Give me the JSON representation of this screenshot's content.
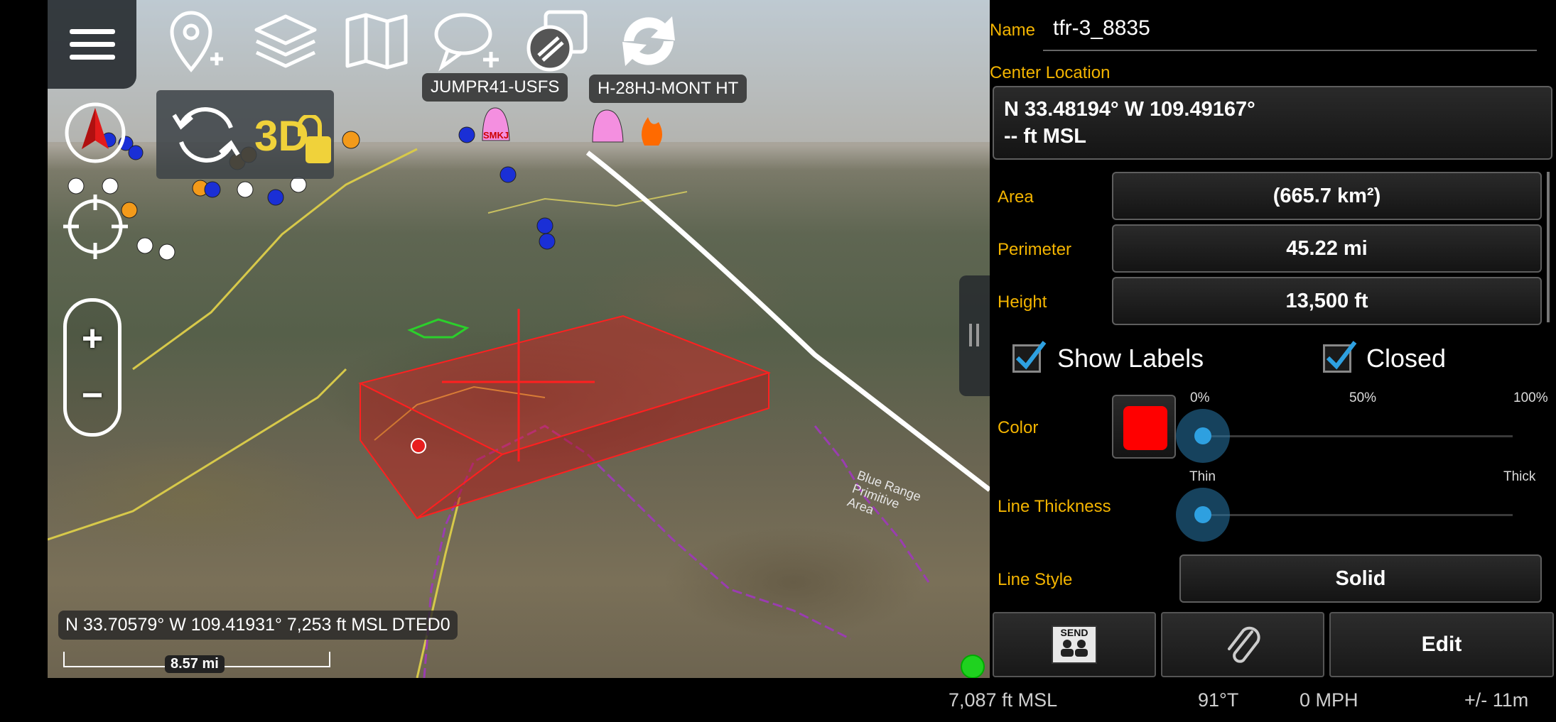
{
  "map": {
    "callsign_labels": [
      "JUMPR41-USFS",
      "H-28HJ-MONT HT"
    ],
    "marker_text": "SMKJ",
    "terrain_label": "Blue Range Primitive Area",
    "lock_mode": "3D",
    "zoom_in": "+",
    "zoom_out": "−",
    "coord_readout": "N 33.70579°  W 109.41931° 7,253 ft MSL DTED0",
    "scale_label": "8.57 mi",
    "shape_color": "#ff0000"
  },
  "toolbar": {
    "icons": [
      "menu-icon",
      "add-point-icon",
      "layers-icon",
      "map-icon",
      "add-chat-icon",
      "overlay-icon",
      "sync-icon"
    ]
  },
  "details": {
    "name_label": "Name",
    "name_value": "tfr-3_8835",
    "center_label": "Center Location",
    "center_line1": "N 33.48194°  W 109.49167°",
    "center_line2": "-- ft MSL",
    "area_label": "Area",
    "area_value": "(665.7 km²)",
    "perimeter_label": "Perimeter",
    "perimeter_value": "45.22 mi",
    "height_label": "Height",
    "height_value": "13,500 ft",
    "show_labels": "Show Labels",
    "show_labels_checked": true,
    "closed": "Closed",
    "closed_checked": true,
    "color_label": "Color",
    "color_value": "#ff0000",
    "opacity_ticks": [
      "0%",
      "50%",
      "100%"
    ],
    "opacity_percent": 0,
    "thickness_label": "Line Thickness",
    "thickness_ticks": [
      "Thin",
      "Thick"
    ],
    "thickness_fraction": 0,
    "line_style_label": "Line Style",
    "line_style_value": "Solid",
    "send_label": "SEND",
    "edit_label": "Edit"
  },
  "status": {
    "altitude": "7,087 ft MSL",
    "heading": "91°T",
    "speed": "0 MPH",
    "accuracy": "+/- 11m"
  }
}
